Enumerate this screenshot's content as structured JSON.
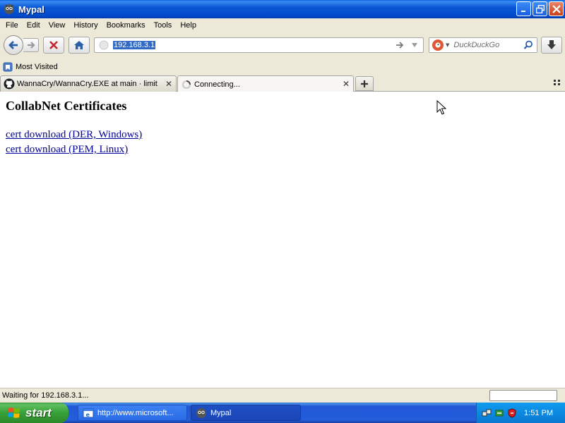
{
  "window": {
    "title": "Mypal"
  },
  "menu": {
    "items": [
      "File",
      "Edit",
      "View",
      "History",
      "Bookmarks",
      "Tools",
      "Help"
    ]
  },
  "toolbar": {
    "url": "192.168.3.1",
    "search_placeholder": "DuckDuckGo",
    "search_engine_icon": "duckduckgo-icon"
  },
  "bookmarks": {
    "items": [
      {
        "label": "Most Visited",
        "icon": "bookmark-folder-icon"
      }
    ]
  },
  "tabs": [
    {
      "label": "WannaCry/WannaCry.EXE at main · limit...",
      "icon": "github-icon",
      "active": false
    },
    {
      "label": "Connecting...",
      "icon": "loading-spinner-icon",
      "active": true
    }
  ],
  "page": {
    "heading": "CollabNet Certificates",
    "links": [
      "cert download (DER, Windows)",
      "cert download (PEM, Linux)"
    ]
  },
  "status": {
    "text": "Waiting for 192.168.3.1..."
  },
  "taskbar": {
    "start_label": "start",
    "tasks": [
      {
        "label": "http://www.microsoft...",
        "icon": "ie-window-icon"
      },
      {
        "label": "Mypal",
        "icon": "mypal-icon"
      }
    ],
    "clock": "1:51 PM"
  },
  "colors": {
    "titlebar": "#0a58d6",
    "taskbar": "#245edb",
    "link": "#00009b",
    "url_selection": "#316ac5",
    "start": "#37a037"
  }
}
